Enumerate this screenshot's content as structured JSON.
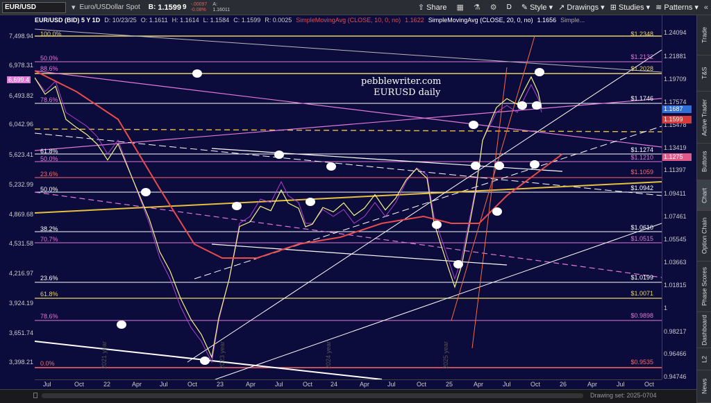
{
  "toolbar": {
    "symbol": "EUR/USD",
    "description": "Euro/USDollar Spot",
    "bid_label": "B:",
    "bid_price": "1.1599",
    "bid_tick": "9",
    "change": "-.00097",
    "change_pct": "-0.08%",
    "ask_label": "A:",
    "ask_price": "1.16011",
    "share_label": "Share",
    "period": "D",
    "style_label": "Style",
    "drawings_label": "Drawings",
    "studies_label": "Studies",
    "patterns_label": "Patterns"
  },
  "infobar": {
    "title": "EUR/USD (BID) 5 Y 1D",
    "date": "D: 10/23/25",
    "open": "O: 1.1611",
    "high": "H: 1.1614",
    "low": "L: 1.1584",
    "close": "C: 1.1599",
    "range": "R: 0.0025",
    "sma10": "SimpleMovingAvg (CLOSE, 10, 0, no)",
    "sma10_val": "1.1622",
    "sma20": "SimpleMovingAvg (CLOSE, 20, 0, no)",
    "sma20_val": "1.1656",
    "more": "Simple..."
  },
  "watermark": {
    "line1": "pebblewriter.com",
    "line2": "EURUSD daily"
  },
  "left_axis": [
    "7,498.94",
    "6,978.31",
    "6,493.82",
    "6,042.96",
    "5,623.41",
    "5,232.99",
    "4,869.68",
    "4,531.58",
    "4,216.97",
    "3,924.19",
    "3,651.74",
    "3,398.21"
  ],
  "left_highlight": "6,699.4",
  "right_axis": [
    "1.24094",
    "1.21881",
    "1.19709",
    "1.17574",
    "1.15478",
    "1.13419",
    "1.11397",
    "1.09411",
    "1.07461",
    "1.05545",
    "1.03663",
    "1.01815",
    "1",
    "0.98217",
    "0.96466",
    "0.94746"
  ],
  "price_tags": [
    {
      "value": "1.1687",
      "color": "#2f6fd6"
    },
    {
      "value": "1.1599",
      "color": "#d63a3a"
    },
    {
      "value": "1.1275",
      "color": "#e05a8a"
    }
  ],
  "fib_left": [
    {
      "label": "100.0%",
      "color": "#e8d56a"
    },
    {
      "label": "50.0%",
      "color": "#e07ad9"
    },
    {
      "label": "88.6%",
      "color": "#e07ad9"
    },
    {
      "label": "78.6%",
      "color": "#e07ad9"
    },
    {
      "label": "61.8%",
      "color": "#ffffff"
    },
    {
      "label": "50.0%",
      "color": "#e07ad9"
    },
    {
      "label": "23.6%",
      "color": "#ff6a6a"
    },
    {
      "label": "50.0%",
      "color": "#ffffff"
    },
    {
      "label": "38.2%",
      "color": "#ffffff"
    },
    {
      "label": "70.7%",
      "color": "#e07ad9"
    },
    {
      "label": "23.6%",
      "color": "#ffffff"
    },
    {
      "label": "61.8%",
      "color": "#e8d56a"
    },
    {
      "label": "78.6%",
      "color": "#e07ad9"
    },
    {
      "label": "0.0%",
      "color": "#ff6a6a"
    }
  ],
  "fib_right": [
    {
      "label": "$1.2348",
      "color": "#e8d56a"
    },
    {
      "label": "$1.2132",
      "color": "#e07ad9"
    },
    {
      "label": "$1.2028",
      "color": "#e8d56a"
    },
    {
      "label": "$1.1746",
      "color": "#ffffff"
    },
    {
      "label": "$1.1274",
      "color": "#ffffff"
    },
    {
      "label": "$1.1210",
      "color": "#e07ad9"
    },
    {
      "label": "$1.1059",
      "color": "#ff6a6a"
    },
    {
      "label": "$1.0942",
      "color": "#ffffff"
    },
    {
      "label": "$1.0610",
      "color": "#ffffff"
    },
    {
      "label": "$1.0515",
      "color": "#e07ad9"
    },
    {
      "label": "$1.0199",
      "color": "#ffffff"
    },
    {
      "label": "$1.0071",
      "color": "#e8d56a"
    },
    {
      "label": "$0.9898",
      "color": "#e07ad9"
    },
    {
      "label": "$0.9535",
      "color": "#ff6a6a"
    }
  ],
  "x_axis": [
    "Jul",
    "Oct",
    "22",
    "Apr",
    "Jul",
    "Oct",
    "23",
    "Apr",
    "Jul",
    "Oct",
    "24",
    "Apr",
    "Jul",
    "Oct",
    "25",
    "Apr",
    "Jul",
    "Oct",
    "26",
    "Apr",
    "Jul",
    "Oct"
  ],
  "year_marks": [
    "2021 year",
    "2023 year",
    "2024 year",
    "2025 year"
  ],
  "status": {
    "drawing_set": "Drawing set: 2025-0704"
  },
  "sidebar": [
    "Trade",
    "T&S",
    "Active Trader",
    "Buttons",
    "Chart",
    "Option Chain",
    "Phase Scores",
    "Dashboard",
    "L2",
    "News"
  ],
  "colors": {
    "background": "#0b0b3c",
    "sma10": "#e84c4c",
    "sma20": "#f5f58a",
    "price": "#b040d0"
  }
}
